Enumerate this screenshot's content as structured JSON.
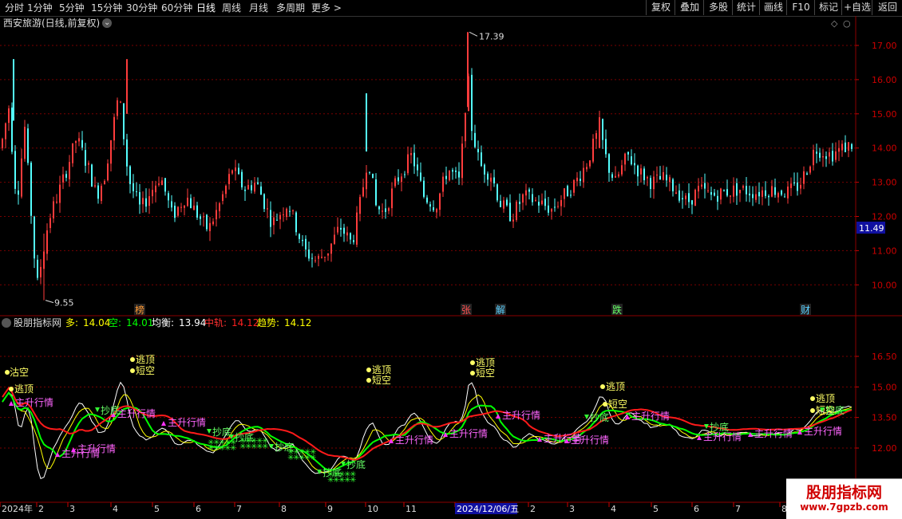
{
  "toolbar": {
    "periods": [
      {
        "label": "分时",
        "active": false
      },
      {
        "label": "1分钟",
        "active": false
      },
      {
        "label": "5分钟",
        "active": false
      },
      {
        "label": "15分钟",
        "active": false
      },
      {
        "label": "30分钟",
        "active": false
      },
      {
        "label": "60分钟",
        "active": false
      },
      {
        "label": "日线",
        "active": true
      },
      {
        "label": "周线",
        "active": false
      },
      {
        "label": "月线",
        "active": false
      },
      {
        "label": "多周期",
        "active": false
      },
      {
        "label": "更多 >",
        "active": false
      }
    ],
    "actions": [
      "复权",
      "叠加",
      "多股",
      "统计",
      "画线",
      "F10",
      "标记",
      "+自选",
      "返回"
    ]
  },
  "main_chart": {
    "title": "西安旅游(日线,前复权)",
    "price_axis": [
      "17.00",
      "16.00",
      "15.00",
      "14.00",
      "13.00",
      "12.00",
      "11.00",
      "10.00"
    ],
    "current_price": "11.49",
    "high_label": "17.39",
    "low_label": "9.55",
    "event_markers": [
      "榜",
      "张",
      "解",
      "跌",
      "财"
    ]
  },
  "indicator": {
    "name": "股朋指标网",
    "legend": [
      {
        "label": "多:",
        "value": "14.04",
        "color": "#ffff00"
      },
      {
        "label": "空:",
        "value": "14.01",
        "color": "#00ff00"
      },
      {
        "label": "均衡:",
        "value": "13.94",
        "color": "#ffffff"
      },
      {
        "label": "中轨:",
        "value": "14.12",
        "color": "#ff2020"
      },
      {
        "label": "趋势:",
        "value": "14.12",
        "color": "#ffff00"
      }
    ],
    "axis": [
      "16.50",
      "15.00",
      "13.50",
      "12.00"
    ],
    "signals": {
      "escape_top": "逃顶",
      "short_empty": "短空",
      "main_rise": "主升行情",
      "bottom_fish": "抄底",
      "tag_empty": "沽空"
    }
  },
  "time_axis": [
    "2024年",
    "2",
    "3",
    "4",
    "5",
    "6",
    "7",
    "8",
    "9",
    "10",
    "11",
    "2024/12/06/五",
    "2",
    "3",
    "4",
    "5",
    "6",
    "7",
    "8"
  ],
  "watermark": {
    "title": "股朋指标网",
    "url": "www.7gpzb.com"
  },
  "colors": {
    "up": "#ff3c3c",
    "down": "#54ffff",
    "grid": "#8b0000",
    "axis": "#c00000"
  }
}
